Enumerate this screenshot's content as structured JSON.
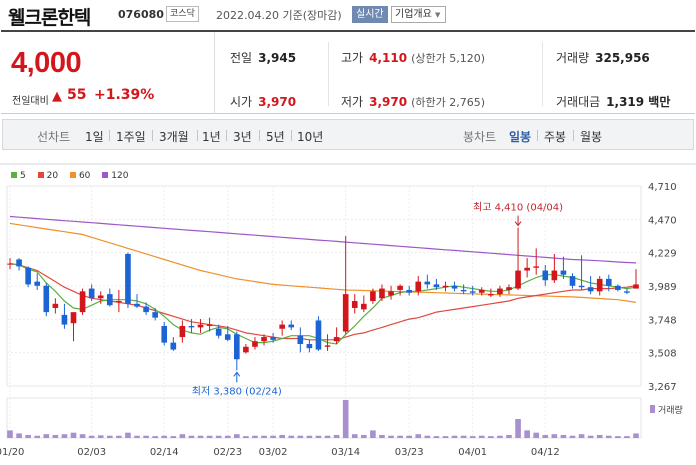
{
  "header": {
    "stock_name": "웰크론한텍",
    "stock_code": "076080",
    "market": "코스닥",
    "date_basis": "2022.04.20 기준(장마감)",
    "realtime_button": "실시간",
    "corp_info_button": "기업개요"
  },
  "quote": {
    "price": "4,000",
    "change_label": "전일대비",
    "change_value": "55",
    "change_rate": "+1.39%",
    "prev_close_label": "전일",
    "prev_close": "3,945",
    "open_label": "시가",
    "open": "3,970",
    "high_label": "고가",
    "high": "4,110",
    "upper_limit": "(상한가 5,120)",
    "low_label": "저가",
    "low": "3,970",
    "lower_limit": "(하한가 2,765)",
    "volume_label": "거래량",
    "volume": "325,956",
    "amount_label": "거래대금",
    "amount": "1,319 백만"
  },
  "periods": {
    "line_chart_label": "선차트",
    "line_options": [
      "1일",
      "1주일",
      "3개월",
      "1년",
      "3년",
      "5년",
      "10년"
    ],
    "candle_chart_label": "봉차트",
    "candle_options": [
      "일봉",
      "주봉",
      "월봉"
    ],
    "active_candle": "일봉"
  },
  "colors": {
    "up": "#d3161b",
    "down": "#1c64d4",
    "ma5": "#58b142",
    "ma20": "#e2473b",
    "ma60": "#f0912c",
    "ma120": "#9d57c8"
  },
  "chart_data": {
    "type": "candlestick",
    "legend": [
      {
        "name": "5",
        "color": "#58b142"
      },
      {
        "name": "20",
        "color": "#e2473b"
      },
      {
        "name": "60",
        "color": "#f0912c"
      },
      {
        "name": "120",
        "color": "#9d57c8"
      }
    ],
    "y_ticks": [
      "4,710",
      "4,470",
      "4,229",
      "3,989",
      "3,748",
      "3,508",
      "3,267"
    ],
    "ylim": [
      3267,
      4710
    ],
    "x_ticks": [
      "01/20",
      "02/03",
      "02/14",
      "02/23",
      "03/02",
      "03/14",
      "03/23",
      "04/01",
      "04/12"
    ],
    "x_tick_index": [
      0,
      9,
      17,
      24,
      29,
      37,
      44,
      51,
      59
    ],
    "annotation_high": "최고 4,410 (04/04)",
    "annotation_low": "최저 3,380 (02/24)",
    "volume_label": "거래량",
    "candles": [
      {
        "o": 4150,
        "h": 4190,
        "l": 4110,
        "c": 4150
      },
      {
        "o": 4180,
        "h": 4190,
        "l": 4100,
        "c": 4130
      },
      {
        "o": 4120,
        "h": 4130,
        "l": 3980,
        "c": 4000
      },
      {
        "o": 4020,
        "h": 4080,
        "l": 3960,
        "c": 3990
      },
      {
        "o": 3990,
        "h": 4010,
        "l": 3770,
        "c": 3800
      },
      {
        "o": 3830,
        "h": 3900,
        "l": 3790,
        "c": 3860
      },
      {
        "o": 3780,
        "h": 3860,
        "l": 3680,
        "c": 3710
      },
      {
        "o": 3720,
        "h": 3790,
        "l": 3590,
        "c": 3800
      },
      {
        "o": 3800,
        "h": 3970,
        "l": 3780,
        "c": 3950
      },
      {
        "o": 3970,
        "h": 4000,
        "l": 3880,
        "c": 3900
      },
      {
        "o": 3900,
        "h": 3950,
        "l": 3860,
        "c": 3920
      },
      {
        "o": 3930,
        "h": 3970,
        "l": 3840,
        "c": 3850
      },
      {
        "o": 3880,
        "h": 3960,
        "l": 3800,
        "c": 3880
      },
      {
        "o": 4220,
        "h": 4230,
        "l": 3830,
        "c": 3860
      },
      {
        "o": 3860,
        "h": 3930,
        "l": 3830,
        "c": 3840
      },
      {
        "o": 3840,
        "h": 3870,
        "l": 3780,
        "c": 3800
      },
      {
        "o": 3800,
        "h": 3830,
        "l": 3740,
        "c": 3760
      },
      {
        "o": 3700,
        "h": 3730,
        "l": 3560,
        "c": 3580
      },
      {
        "o": 3580,
        "h": 3620,
        "l": 3520,
        "c": 3530
      },
      {
        "o": 3620,
        "h": 3740,
        "l": 3580,
        "c": 3700
      },
      {
        "o": 3700,
        "h": 3750,
        "l": 3650,
        "c": 3690
      },
      {
        "o": 3690,
        "h": 3750,
        "l": 3650,
        "c": 3710
      },
      {
        "o": 3700,
        "h": 3760,
        "l": 3660,
        "c": 3710
      },
      {
        "o": 3680,
        "h": 3710,
        "l": 3610,
        "c": 3630
      },
      {
        "o": 3640,
        "h": 3700,
        "l": 3590,
        "c": 3600
      },
      {
        "o": 3640,
        "h": 3660,
        "l": 3380,
        "c": 3460
      },
      {
        "o": 3510,
        "h": 3570,
        "l": 3500,
        "c": 3550
      },
      {
        "o": 3550,
        "h": 3620,
        "l": 3530,
        "c": 3590
      },
      {
        "o": 3590,
        "h": 3640,
        "l": 3560,
        "c": 3620
      },
      {
        "o": 3620,
        "h": 3650,
        "l": 3580,
        "c": 3600
      },
      {
        "o": 3680,
        "h": 3740,
        "l": 3630,
        "c": 3710
      },
      {
        "o": 3710,
        "h": 3740,
        "l": 3670,
        "c": 3690
      },
      {
        "o": 3630,
        "h": 3690,
        "l": 3510,
        "c": 3570
      },
      {
        "o": 3570,
        "h": 3600,
        "l": 3510,
        "c": 3540
      },
      {
        "o": 3740,
        "h": 3770,
        "l": 3520,
        "c": 3530
      },
      {
        "o": 3550,
        "h": 3640,
        "l": 3520,
        "c": 3560
      },
      {
        "o": 3590,
        "h": 3690,
        "l": 3570,
        "c": 3620
      },
      {
        "o": 3660,
        "h": 4350,
        "l": 3640,
        "c": 3930
      },
      {
        "o": 3830,
        "h": 3930,
        "l": 3790,
        "c": 3880
      },
      {
        "o": 3820,
        "h": 3920,
        "l": 3800,
        "c": 3860
      },
      {
        "o": 3880,
        "h": 3970,
        "l": 3860,
        "c": 3950
      },
      {
        "o": 3900,
        "h": 4000,
        "l": 3880,
        "c": 3970
      },
      {
        "o": 3920,
        "h": 3990,
        "l": 3890,
        "c": 3950
      },
      {
        "o": 3960,
        "h": 4000,
        "l": 3920,
        "c": 3990
      },
      {
        "o": 3960,
        "h": 3990,
        "l": 3920,
        "c": 3940
      },
      {
        "o": 3950,
        "h": 4060,
        "l": 3920,
        "c": 4020
      },
      {
        "o": 4020,
        "h": 4070,
        "l": 3970,
        "c": 4000
      },
      {
        "o": 4000,
        "h": 4040,
        "l": 3960,
        "c": 3980
      },
      {
        "o": 3980,
        "h": 4020,
        "l": 3950,
        "c": 3990
      },
      {
        "o": 3990,
        "h": 4020,
        "l": 3950,
        "c": 3970
      },
      {
        "o": 3960,
        "h": 4000,
        "l": 3930,
        "c": 3950
      },
      {
        "o": 3950,
        "h": 3990,
        "l": 3920,
        "c": 3940
      },
      {
        "o": 3940,
        "h": 3980,
        "l": 3920,
        "c": 3960
      },
      {
        "o": 3920,
        "h": 3970,
        "l": 3910,
        "c": 3930
      },
      {
        "o": 3930,
        "h": 3990,
        "l": 3910,
        "c": 3970
      },
      {
        "o": 3960,
        "h": 4000,
        "l": 3930,
        "c": 3980
      },
      {
        "o": 3970,
        "h": 4410,
        "l": 3960,
        "c": 4100
      },
      {
        "o": 4100,
        "h": 4190,
        "l": 4050,
        "c": 4120
      },
      {
        "o": 4120,
        "h": 4260,
        "l": 4070,
        "c": 4130
      },
      {
        "o": 4100,
        "h": 4140,
        "l": 3990,
        "c": 4030
      },
      {
        "o": 4030,
        "h": 4220,
        "l": 4010,
        "c": 4100
      },
      {
        "o": 4100,
        "h": 4200,
        "l": 4040,
        "c": 4070
      },
      {
        "o": 4060,
        "h": 4080,
        "l": 3970,
        "c": 3990
      },
      {
        "o": 3990,
        "h": 4210,
        "l": 3960,
        "c": 3980
      },
      {
        "o": 3980,
        "h": 4060,
        "l": 3930,
        "c": 3950
      },
      {
        "o": 3950,
        "h": 4060,
        "l": 3920,
        "c": 4040
      },
      {
        "o": 4040,
        "h": 4070,
        "l": 3950,
        "c": 3990
      },
      {
        "o": 3990,
        "h": 4000,
        "l": 3950,
        "c": 3960
      },
      {
        "o": 3950,
        "h": 3970,
        "l": 3930,
        "c": 3940
      },
      {
        "o": 3970,
        "h": 4110,
        "l": 3970,
        "c": 4000
      }
    ],
    "volumes": [
      20,
      12,
      8,
      6,
      10,
      8,
      10,
      14,
      10,
      6,
      7,
      6,
      6,
      14,
      6,
      6,
      5,
      6,
      5,
      10,
      6,
      6,
      6,
      6,
      6,
      10,
      5,
      6,
      6,
      6,
      8,
      6,
      6,
      6,
      6,
      6,
      8,
      100,
      10,
      8,
      20,
      8,
      6,
      6,
      6,
      10,
      6,
      5,
      5,
      6,
      6,
      5,
      6,
      5,
      6,
      8,
      50,
      20,
      14,
      8,
      10,
      8,
      6,
      10,
      6,
      8,
      6,
      5,
      5,
      12
    ],
    "ma5": [
      4150,
      4140,
      4110,
      4090,
      4010,
      3950,
      3880,
      3830,
      3820,
      3850,
      3880,
      3890,
      3890,
      3890,
      3880,
      3860,
      3820,
      3770,
      3710,
      3670,
      3650,
      3640,
      3670,
      3690,
      3680,
      3640,
      3610,
      3580,
      3580,
      3590,
      3610,
      3630,
      3630,
      3630,
      3610,
      3580,
      3570,
      3640,
      3700,
      3770,
      3830,
      3900,
      3920,
      3940,
      3950,
      3950,
      3960,
      3970,
      3980,
      3990,
      3980,
      3970,
      3960,
      3950,
      3950,
      3960,
      3990,
      4020,
      4050,
      4070,
      4070,
      4060,
      4050,
      4030,
      4010,
      4000,
      3990,
      3980,
      3970,
      3980
    ],
    "ma20": [
      4150,
      4140,
      4120,
      4100,
      4060,
      4020,
      3980,
      3950,
      3920,
      3900,
      3890,
      3880,
      3870,
      3860,
      3850,
      3830,
      3810,
      3790,
      3770,
      3750,
      3730,
      3720,
      3710,
      3700,
      3690,
      3670,
      3650,
      3640,
      3630,
      3620,
      3610,
      3610,
      3610,
      3600,
      3600,
      3600,
      3600,
      3620,
      3640,
      3650,
      3670,
      3690,
      3710,
      3730,
      3750,
      3760,
      3780,
      3800,
      3810,
      3820,
      3830,
      3840,
      3850,
      3860,
      3870,
      3880,
      3900,
      3910,
      3920,
      3930,
      3940,
      3950,
      3960,
      3960,
      3970,
      3970,
      3970,
      3975,
      3980,
      3990
    ],
    "ma60": [
      4440,
      4430,
      4420,
      4410,
      4400,
      4390,
      4380,
      4370,
      4360,
      4340,
      4320,
      4300,
      4280,
      4260,
      4240,
      4220,
      4200,
      4180,
      4160,
      4140,
      4120,
      4100,
      4085,
      4070,
      4055,
      4040,
      4030,
      4020,
      4010,
      4000,
      3995,
      3990,
      3985,
      3980,
      3975,
      3970,
      3965,
      3960,
      3958,
      3956,
      3954,
      3952,
      3950,
      3948,
      3946,
      3944,
      3942,
      3940,
      3938,
      3936,
      3934,
      3932,
      3930,
      3928,
      3926,
      3924,
      3922,
      3920,
      3918,
      3916,
      3914,
      3912,
      3910,
      3906,
      3902,
      3898,
      3894,
      3890,
      3880,
      3870
    ],
    "ma120": [
      4490,
      4485,
      4480,
      4475,
      4470,
      4465,
      4460,
      4455,
      4450,
      4445,
      4440,
      4435,
      4430,
      4425,
      4420,
      4415,
      4410,
      4405,
      4400,
      4395,
      4390,
      4385,
      4380,
      4375,
      4370,
      4365,
      4360,
      4355,
      4350,
      4345,
      4340,
      4335,
      4330,
      4325,
      4320,
      4315,
      4310,
      4305,
      4300,
      4295,
      4290,
      4285,
      4280,
      4275,
      4270,
      4265,
      4260,
      4255,
      4250,
      4245,
      4240,
      4235,
      4230,
      4225,
      4220,
      4215,
      4210,
      4205,
      4200,
      4195,
      4190,
      4185,
      4180,
      4177,
      4174,
      4170,
      4166,
      4162,
      4158,
      4155
    ]
  }
}
